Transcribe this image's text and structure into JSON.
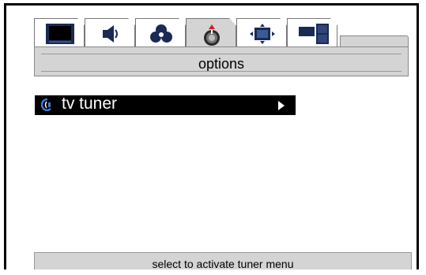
{
  "header": {
    "title": "options",
    "tabs": [
      {
        "icon": "tv-screen-icon",
        "active": false
      },
      {
        "icon": "speaker-icon",
        "active": false
      },
      {
        "icon": "color-circles-icon",
        "active": false
      },
      {
        "icon": "settings-knob-icon",
        "active": true
      },
      {
        "icon": "screen-position-icon",
        "active": false
      },
      {
        "icon": "picture-in-picture-icon",
        "active": false
      }
    ]
  },
  "menu": {
    "items": [
      {
        "label": "tv tuner",
        "icon": "tuner-icon",
        "selected": true,
        "has_submenu": true
      }
    ]
  },
  "status": {
    "text": "select to activate tuner menu"
  },
  "colors": {
    "panel_gray": "#d4d4d4",
    "selection_bg": "#000000",
    "selection_text": "#ffffff",
    "icon_navy": "#1a2a55",
    "tuner_icon_blue": "#3a7bd5"
  }
}
